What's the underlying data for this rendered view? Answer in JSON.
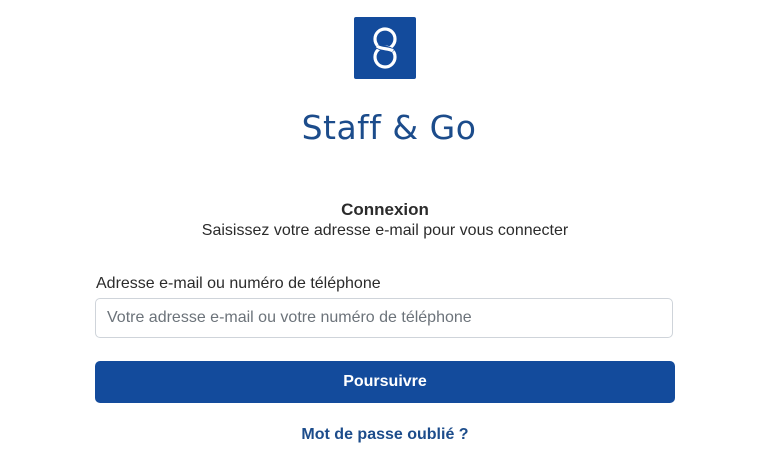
{
  "brand": {
    "name": "Staff & Go",
    "logo_icon": "linked-rings-icon",
    "logo_color": "#134b9c"
  },
  "login": {
    "heading": "Connexion",
    "subheading": "Saisissez votre adresse e-mail pour vous connecter",
    "field_label": "Adresse e-mail ou numéro de téléphone",
    "field_value": "",
    "field_placeholder": "Votre adresse e-mail ou votre numéro de téléphone",
    "submit_label": "Poursuivre",
    "forgot_password_label": "Mot de passe oublié ?"
  },
  "colors": {
    "primary": "#134b9c",
    "link": "#1c4c8b",
    "text": "#2b2b2b",
    "placeholder": "#6c737a",
    "input_border": "#cfd4da"
  }
}
